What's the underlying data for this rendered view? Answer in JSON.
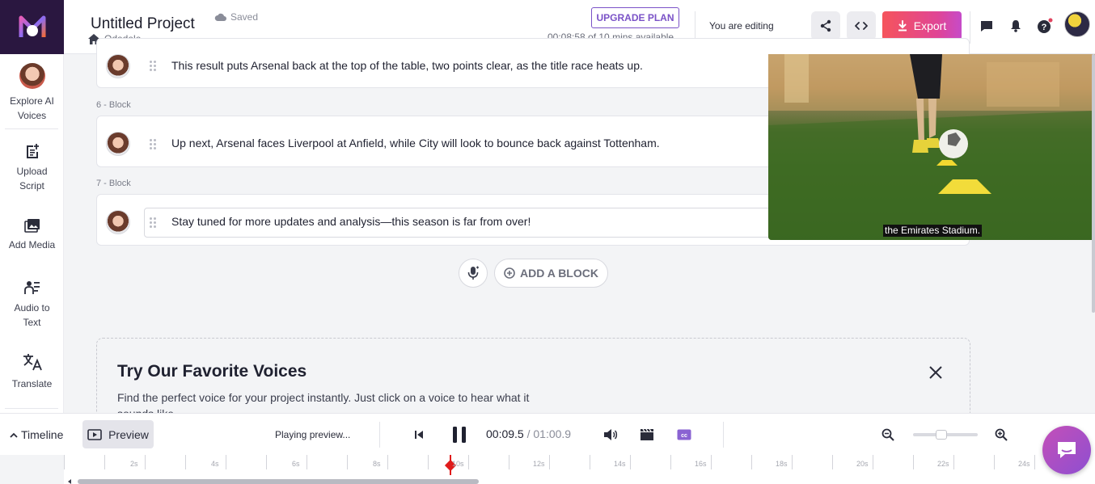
{
  "header": {
    "project_title": "Untitled Project",
    "saved_label": "Saved",
    "workspace": "Odedele",
    "upgrade_label": "UPGRADE PLAN",
    "minutes_available": "00:08:58 of 10 mins available",
    "editing_label": "You are editing",
    "export_label": "Export"
  },
  "sidebar": {
    "items": [
      {
        "label": "Explore AI Voices",
        "icon": "voice-avatar"
      },
      {
        "label": "Upload Script",
        "icon": "upload-script-icon"
      },
      {
        "label": "Add Media",
        "icon": "media-icon"
      },
      {
        "label": "Audio to Text",
        "icon": "audio-to-text-icon"
      },
      {
        "label": "Translate",
        "icon": "translate-icon"
      }
    ]
  },
  "blocks": [
    {
      "text": "This result puts Arsenal back at the top of the table, two points clear, as the title race heats up."
    },
    {
      "label": "6 -  Block",
      "text": "Up next, Arsenal faces Liverpool at Anfield, while City will look to bounce back against Tottenham."
    },
    {
      "label": "7 -  Block",
      "text": "Stay tuned for more updates and analysis—this season is far from over!"
    }
  ],
  "add_block_label": "ADD A BLOCK",
  "favorites": {
    "title": "Try Our Favorite Voices",
    "description": "Find the perfect voice for your project instantly. Just click on a voice to hear what it sounds like."
  },
  "video": {
    "caption": "the Emirates Stadium."
  },
  "bottom": {
    "timeline_label": "Timeline",
    "preview_label": "Preview",
    "status": "Playing preview...",
    "current_time": "00:09.5",
    "total_time": " / 01:00.9"
  },
  "ruler": {
    "labels": [
      "2s",
      "4s",
      "6s",
      "8s",
      "10s",
      "12s",
      "14s",
      "16s",
      "18s",
      "20s",
      "22s",
      "24s"
    ]
  },
  "colors": {
    "accent": "#7a52c7",
    "export_gradient_start": "#f5545c",
    "playhead": "#e01b1b"
  }
}
